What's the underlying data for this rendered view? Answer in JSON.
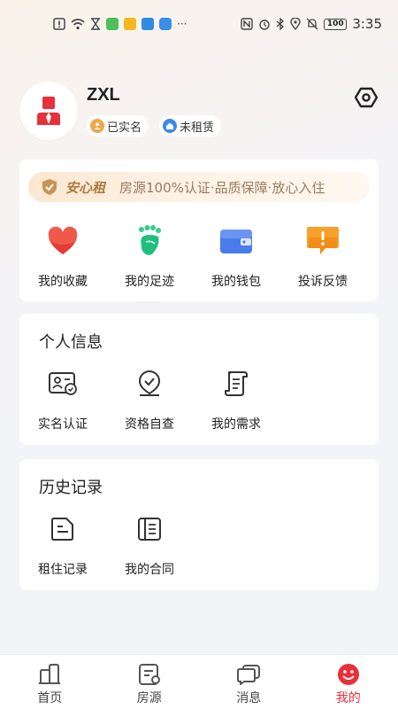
{
  "status_bar": {
    "time": "3:35",
    "battery": "100",
    "left_icons": [
      "alert-icon",
      "wifi-icon",
      "hourglass-icon",
      "app-icon-green",
      "app-icon-yellow",
      "app-icon-blue",
      "cloud-icon",
      "more-dots-icon"
    ],
    "more": "···"
  },
  "profile": {
    "username": "ZXL",
    "badge_verified": "已实名",
    "badge_rent": "未租赁"
  },
  "assurance": {
    "brand": "安心租",
    "text": "房源100%认证·品质保障·放心入住"
  },
  "quick_actions": [
    {
      "label": "我的收藏",
      "icon": "heart-icon"
    },
    {
      "label": "我的足迹",
      "icon": "footprint-icon"
    },
    {
      "label": "我的钱包",
      "icon": "wallet-icon"
    },
    {
      "label": "投诉反馈",
      "icon": "feedback-icon"
    }
  ],
  "personal_info": {
    "title": "个人信息",
    "items": [
      {
        "label": "实名认证",
        "icon": "id-card-icon"
      },
      {
        "label": "资格自查",
        "icon": "qualification-icon"
      },
      {
        "label": "我的需求",
        "icon": "scroll-icon"
      }
    ]
  },
  "history": {
    "title": "历史记录",
    "items": [
      {
        "label": "租住记录",
        "icon": "document-icon"
      },
      {
        "label": "我的合同",
        "icon": "contract-icon"
      }
    ]
  },
  "tabs": [
    {
      "label": "首页",
      "icon": "home-icon"
    },
    {
      "label": "房源",
      "icon": "listing-icon"
    },
    {
      "label": "消息",
      "icon": "message-icon"
    },
    {
      "label": "我的",
      "icon": "profile-icon",
      "active": true
    }
  ],
  "colors": {
    "accent": "#e8303a",
    "brand_gold": "#b07a3c"
  }
}
